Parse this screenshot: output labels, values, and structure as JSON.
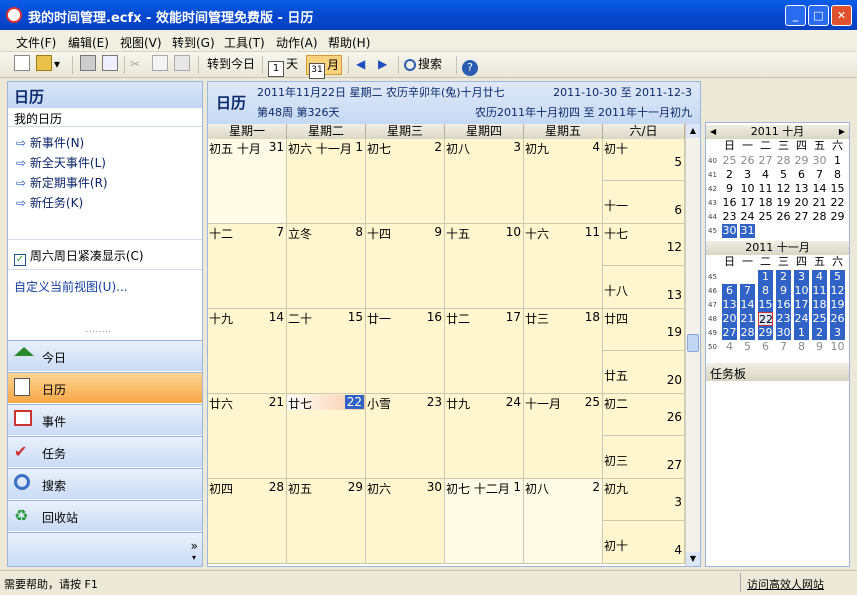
{
  "window": {
    "title": "我的时间管理.ecfx - 效能时间管理免费版 - 日历",
    "min": "_",
    "max": "□",
    "close": "✕"
  },
  "menu": [
    "文件(F)",
    "编辑(E)",
    "视图(V)",
    "转到(G)",
    "工具(T)",
    "动作(A)",
    "帮助(H)"
  ],
  "toolbar": {
    "goto_today": "转到今日",
    "day": "天",
    "month": "月",
    "search": "搜索",
    "day_icon_num": "1",
    "month_icon_num": "31"
  },
  "left": {
    "title": "日历",
    "subtitle": "我的日历",
    "actions": [
      "新事件(N)",
      "新全天事件(L)",
      "新定期事件(R)",
      "新任务(K)"
    ],
    "compact_weekend": "周六周日紧凑显示(C)",
    "customize": "自定义当前视图(U)...",
    "nav": [
      "今日",
      "日历",
      "事件",
      "任务",
      "搜索",
      "回收站"
    ]
  },
  "header": {
    "title": "日历",
    "date": "2011年11月22日",
    "weekday": "星期二",
    "lunar": "农历辛卯年(兔)十月廿七",
    "range": "2011-10-30 至 2011-12-3",
    "week": "第48周 第326天",
    "lunar_range": "农历2011年十月初四 至 2011年十一月初九"
  },
  "columns": [
    "星期一",
    "星期二",
    "星期三",
    "星期四",
    "星期五",
    "六/日"
  ],
  "weeks": [
    {
      "cells": [
        [
          "初五 十月",
          "31"
        ],
        [
          "初六 十一月",
          "1"
        ],
        [
          "初七",
          "2"
        ],
        [
          "初八",
          "3"
        ],
        [
          "初九",
          "4"
        ]
      ],
      "sat": [
        "初十",
        "5"
      ],
      "sun": [
        "十一",
        "6"
      ]
    },
    {
      "cells": [
        [
          "十二",
          "7"
        ],
        [
          "立冬",
          "8"
        ],
        [
          "十四",
          "9"
        ],
        [
          "十五",
          "10"
        ],
        [
          "十六",
          "11"
        ]
      ],
      "sat": [
        "十七",
        "12"
      ],
      "sun": [
        "十八",
        "13"
      ]
    },
    {
      "cells": [
        [
          "十九",
          "14"
        ],
        [
          "二十",
          "15"
        ],
        [
          "廿一",
          "16"
        ],
        [
          "廿二",
          "17"
        ],
        [
          "廿三",
          "18"
        ]
      ],
      "sat": [
        "廿四",
        "19"
      ],
      "sun": [
        "廿五",
        "20"
      ]
    },
    {
      "cells": [
        [
          "廿六",
          "21"
        ],
        [
          "廿七",
          "22"
        ],
        [
          "小雪",
          "23"
        ],
        [
          "廿九",
          "24"
        ],
        [
          "十一月",
          "25"
        ]
      ],
      "sat": [
        "初二",
        "26"
      ],
      "sun": [
        "初三",
        "27"
      ]
    },
    {
      "cells": [
        [
          "初四",
          "28"
        ],
        [
          "初五",
          "29"
        ],
        [
          "初六",
          "30"
        ],
        [
          "初七 十二月",
          "1"
        ],
        [
          "初八",
          "2"
        ]
      ],
      "sat": [
        "初九",
        "3"
      ],
      "sun": [
        "初十",
        "4"
      ]
    }
  ],
  "minical": {
    "oct": {
      "title": "2011 十月",
      "weekdays": [
        "日",
        "一",
        "二",
        "三",
        "四",
        "五",
        "六"
      ],
      "weeknums": [
        "40",
        "41",
        "42",
        "43",
        "44",
        "45"
      ],
      "rows": [
        [
          "25",
          "26",
          "27",
          "28",
          "29",
          "30",
          "1"
        ],
        [
          "2",
          "3",
          "4",
          "5",
          "6",
          "7",
          "8"
        ],
        [
          "9",
          "10",
          "11",
          "12",
          "13",
          "14",
          "15"
        ],
        [
          "16",
          "17",
          "18",
          "19",
          "20",
          "21",
          "22"
        ],
        [
          "23",
          "24",
          "25",
          "26",
          "27",
          "28",
          "29"
        ],
        [
          "30",
          "31",
          "",
          "",
          "",
          "",
          ""
        ]
      ]
    },
    "nov": {
      "title": "2011 十一月",
      "weekdays": [
        "日",
        "一",
        "二",
        "三",
        "四",
        "五",
        "六"
      ],
      "weeknums": [
        "45",
        "46",
        "47",
        "48",
        "49",
        "50"
      ],
      "rows": [
        [
          "",
          "",
          "1",
          "2",
          "3",
          "4",
          "5"
        ],
        [
          "6",
          "7",
          "8",
          "9",
          "10",
          "11",
          "12"
        ],
        [
          "13",
          "14",
          "15",
          "16",
          "17",
          "18",
          "19"
        ],
        [
          "20",
          "21",
          "22",
          "23",
          "24",
          "25",
          "26"
        ],
        [
          "27",
          "28",
          "29",
          "30",
          "1",
          "2",
          "3"
        ],
        [
          "4",
          "5",
          "6",
          "7",
          "8",
          "9",
          "10"
        ]
      ]
    },
    "taskpad": "任务板"
  },
  "status": {
    "left": "需要帮助，请按 F1",
    "right": "访问高效人网站"
  },
  "colors": {
    "title": "#0748d0",
    "cell": "#fff5cf",
    "selection": "#3163c6",
    "nav_selected": "#f7a745"
  }
}
